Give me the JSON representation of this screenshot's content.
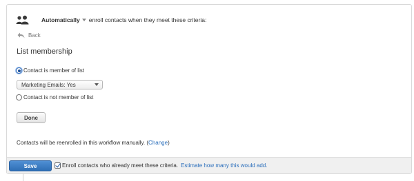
{
  "header": {
    "icon": "contacts-group-icon",
    "mode_label": "Automatically",
    "text": "enroll contacts when they meet these criteria:"
  },
  "back": {
    "label": "Back",
    "icon": "back-arrow-icon"
  },
  "section": {
    "title": "List membership"
  },
  "options": [
    {
      "label": "Contact is member of list",
      "selected": true
    },
    {
      "label": "Contact is not member of list",
      "selected": false
    }
  ],
  "list_select": {
    "value": "Marketing Emails: Yes"
  },
  "done_label": "Done",
  "reenroll": {
    "text": "Contacts will be reenrolled in this workflow manually. (",
    "link": "Change",
    "close": ")"
  },
  "footer": {
    "save_label": "Save",
    "enroll_checked": true,
    "enroll_text": "Enroll contacts who already meet these criteria.",
    "estimate_link": "Estimate how many this would add."
  },
  "colors": {
    "accent": "#2f6fb6",
    "link": "#2a6ebb",
    "footer_bg": "#f0f0f0"
  }
}
